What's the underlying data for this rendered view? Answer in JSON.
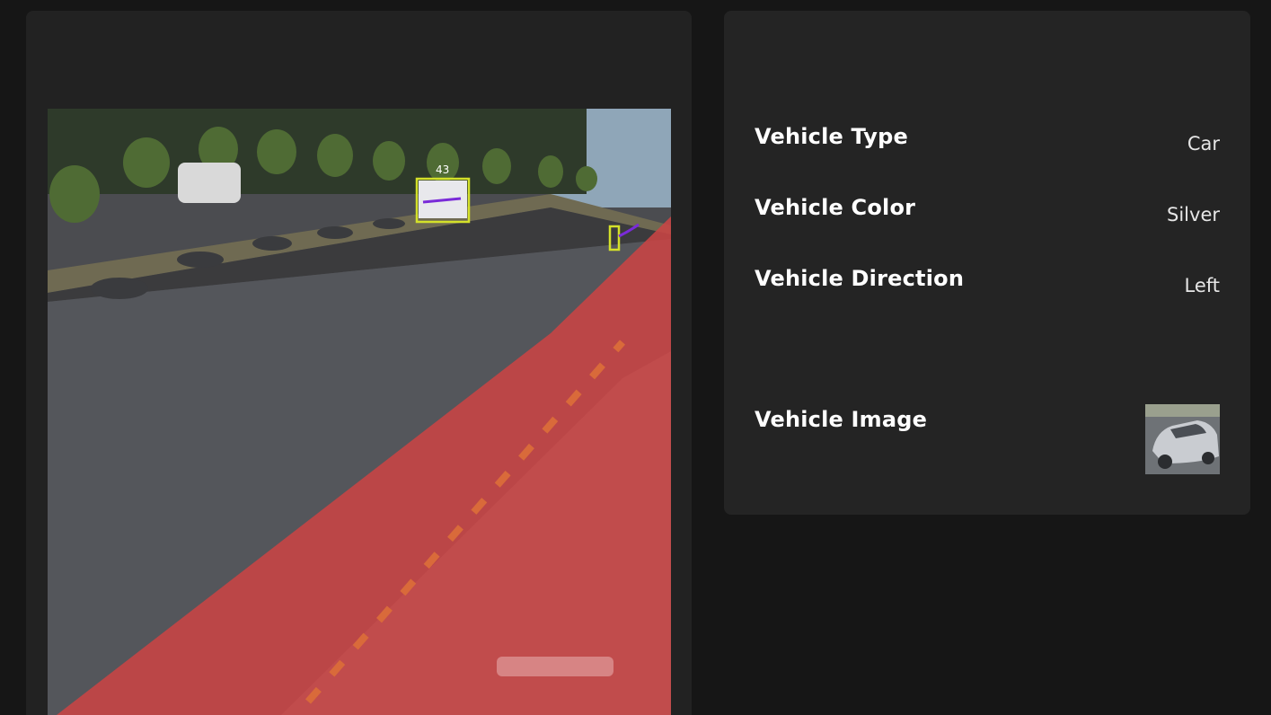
{
  "details": {
    "type_label": "Vehicle Type",
    "type_value": "Car",
    "color_label": "Vehicle Color",
    "color_value": "Silver",
    "direction_label": "Vehicle Direction",
    "direction_value": "Left",
    "image_label": "Vehicle Image"
  },
  "camera": {
    "detection_label": "43",
    "lane_overlay_color": "#d33a3a",
    "box_color": "#d4e12a",
    "track_color": "#7a2bd8"
  }
}
